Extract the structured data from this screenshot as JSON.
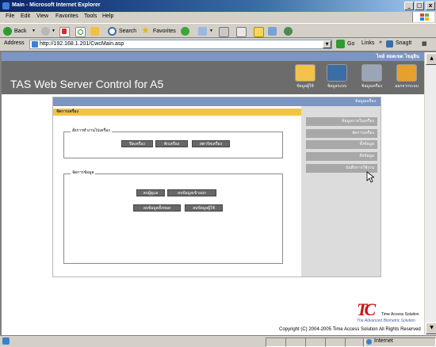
{
  "window": {
    "title": "Main - Microsoft Internet Explorer",
    "min": "_",
    "max": "□",
    "close": "x"
  },
  "menu": [
    "File",
    "Edit",
    "View",
    "Favorites",
    "Tools",
    "Help"
  ],
  "toolbar": {
    "back": "Back",
    "search": "Search",
    "favorites": "Favorites"
  },
  "address": {
    "label": "Address",
    "url": "http://192.168.1.201/CwcMain.asp",
    "go": "Go",
    "links": "Links",
    "snagit": "SnagIt"
  },
  "page": {
    "user_text": "ไทย์ สอดเขต ไขอุยิน",
    "app_title": "TAS Web Server Control for A5",
    "nav": [
      "ข้อมูลผู้ใช้",
      "ข้อมูลระบบ",
      "ข้อมูลเครื่อง",
      "ออกจากระบบ"
    ],
    "panel_title": "ข้อมูลเครื่อง",
    "section_title": "จัดการเครื่อง",
    "group1": {
      "label": "สั่งการทำงานไปเครื่อง",
      "buttons": [
        "ปิดเครื่อง",
        "พักเครื่อง",
        "สตาร์ทเครื่อง"
      ]
    },
    "group2": {
      "label": "จัดการข้อมูล",
      "buttons": [
        "ลบผู้ดูแล",
        "ลบข้อมูลเข้าออก",
        "ลบข้อมูลทั้งหมด",
        "ลบข้อมูลผู้ใช้"
      ]
    },
    "sidebar": [
      "ข้อมูลภายในเครื่อง",
      "จัดการเครื่อง",
      "ตั้งข้อมูล",
      "ดึงข้อมูล",
      "บันทึกการใช้งาน"
    ],
    "logo": {
      "letters": "TC",
      "name": "Time Access Solution",
      "tagline": "The Advanced Biometric Solution"
    },
    "copyright": "Copyright (C) 2004-2005 Time Access Solution All Rights Reserved"
  },
  "status": {
    "zone": "Internet"
  },
  "colors": {
    "titlebar": "#0a246a",
    "header": "#6c6c6c",
    "accent": "#7b96c3",
    "section": "#f5c342",
    "button": "#686868",
    "logo_red": "#cc1111"
  }
}
